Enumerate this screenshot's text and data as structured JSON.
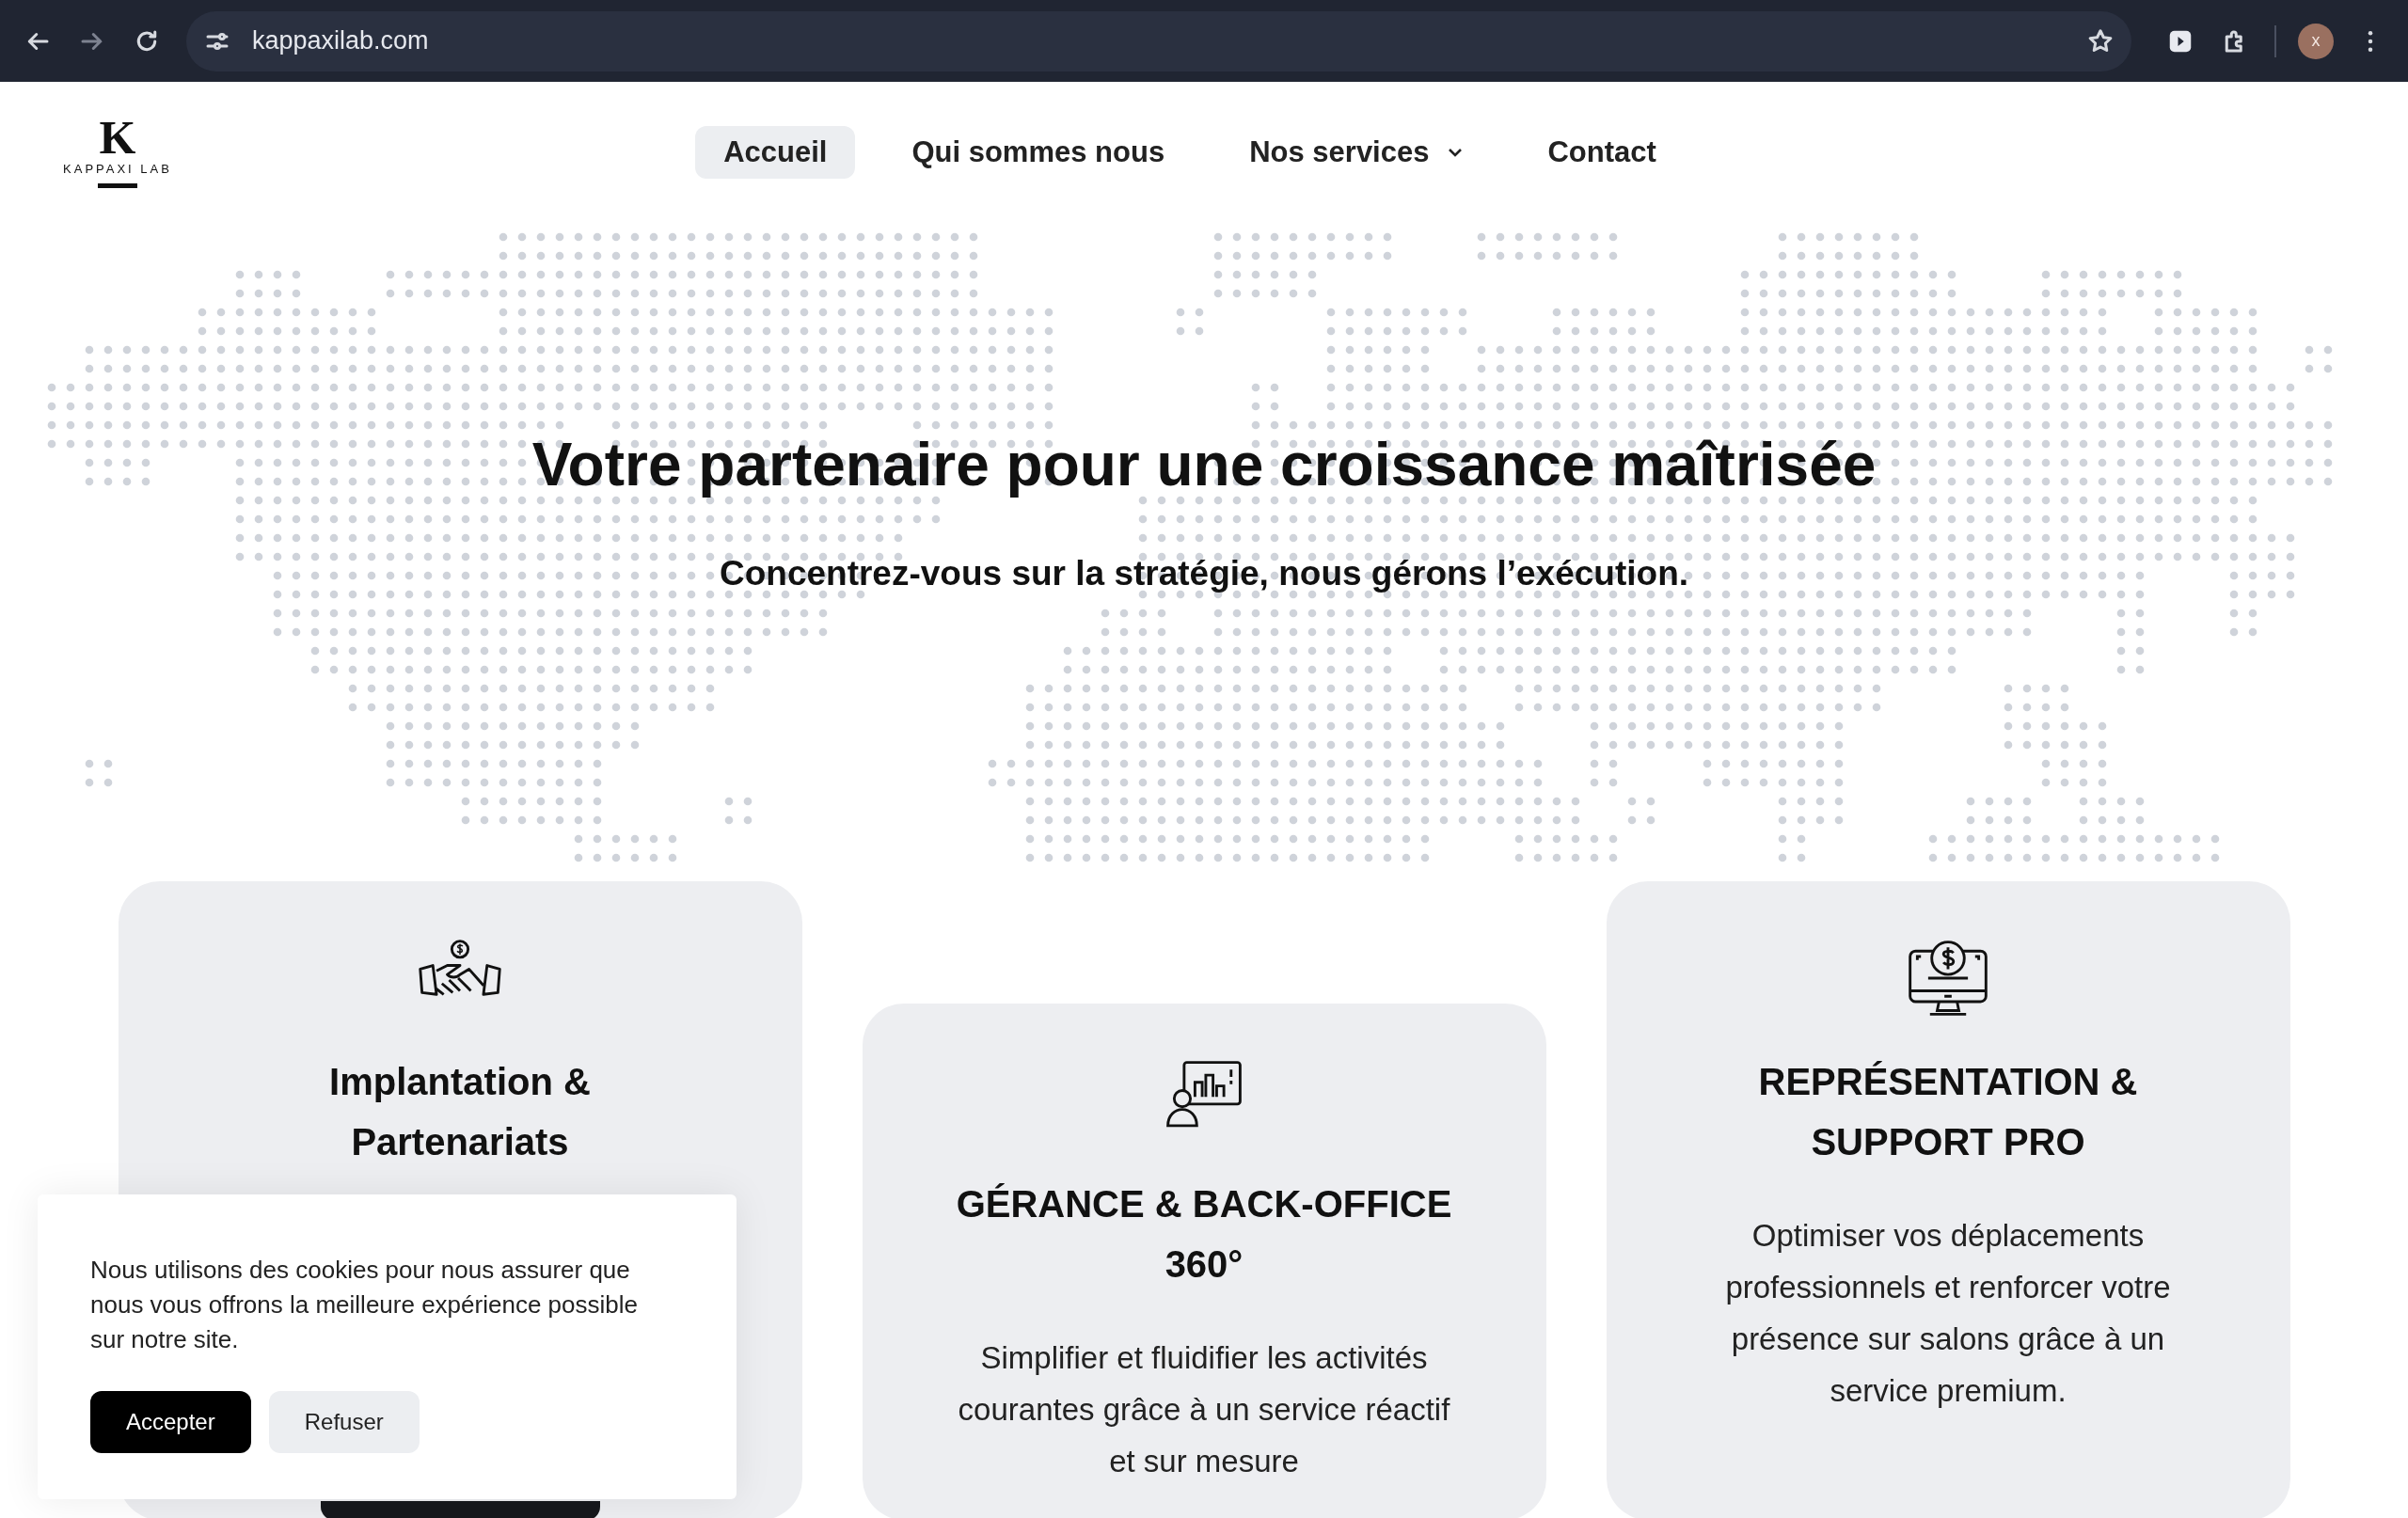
{
  "browser": {
    "url": "kappaxilab.com",
    "profile_initial": "x"
  },
  "logo": {
    "mark": "K",
    "name": "KAPPAXI LAB"
  },
  "nav": [
    {
      "label": "Accueil",
      "selected": true,
      "dropdown": false
    },
    {
      "label": "Qui sommes nous",
      "selected": false,
      "dropdown": false
    },
    {
      "label": "Nos services",
      "selected": false,
      "dropdown": true
    },
    {
      "label": "Contact",
      "selected": false,
      "dropdown": false
    }
  ],
  "hero": {
    "title": "Votre partenaire pour une croissance maîtrisée",
    "subtitle": "Concentrez-vous sur la stratégie, nous gérons l’exécution."
  },
  "cards": [
    {
      "kind": "handshake",
      "title": "Implantation &\nPartenariats",
      "has_button": true
    },
    {
      "kind": "chart",
      "title": "GÉRANCE & BACK-OFFICE\n360°",
      "text": "Simplifier et fluidifier les activités courantes grâce à un service réactif et sur mesure"
    },
    {
      "kind": "monitor",
      "title": "REPRÉSENTATION &\nSUPPORT PRO",
      "text": "Optimiser vos déplacements professionnels et renforcer votre présence sur salons grâce à un service premium."
    }
  ],
  "cookie_banner": {
    "text": "Nous utilisons des cookies pour nous assurer que nous vous offrons la meilleure expérience possible sur notre site.",
    "buttons": [
      {
        "label": "Accepter",
        "kind": "primary"
      },
      {
        "label": "Refuser",
        "kind": "secondary"
      }
    ]
  }
}
